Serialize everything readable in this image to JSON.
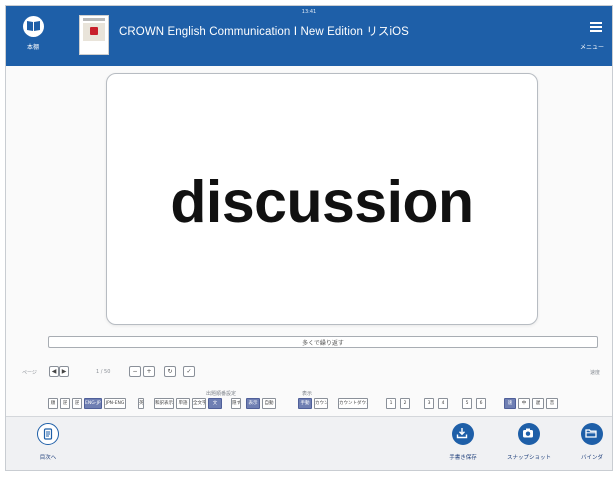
{
  "header": {
    "status_time": "13:41",
    "home_label": "本棚",
    "app_title": "CROWN English Communication Ⅰ New Edition リスiOS",
    "menu_label": "メニュー"
  },
  "card": {
    "word": "discussion"
  },
  "replay_strip": {
    "label": "多くで繰り返す"
  },
  "controls": {
    "row1_tiny_left": "ページ",
    "row1_mid_label": "1 / 50",
    "row1_right_tiny": "速度",
    "group_order": "出題順番設定",
    "group_show": "表示",
    "options": [
      "順",
      "逆",
      "ENG-JPN",
      "JPN-ENG",
      "和訳表示",
      "英語",
      "単語",
      "全文字",
      "文",
      "隠す",
      "表示",
      "自動",
      "手動",
      "カウントダウン",
      "1",
      "2",
      "3",
      "4",
      "5",
      "6",
      "速",
      "中",
      "遅",
      "音"
    ]
  },
  "bottom": {
    "left_label": "目次へ",
    "save_label": "手書き保存",
    "snapshot_label": "スナップショット",
    "binder_label": "バインダ"
  },
  "colors": {
    "header_bg": "#1e5fa8",
    "accent": "#1e5fa8",
    "option_on": "#6f7fb3"
  },
  "icons": {
    "home": "book-icon",
    "menu": "hamburger-icon",
    "toc": "document-icon",
    "save": "download-icon",
    "snapshot": "camera-icon",
    "binder": "folder-icon"
  }
}
